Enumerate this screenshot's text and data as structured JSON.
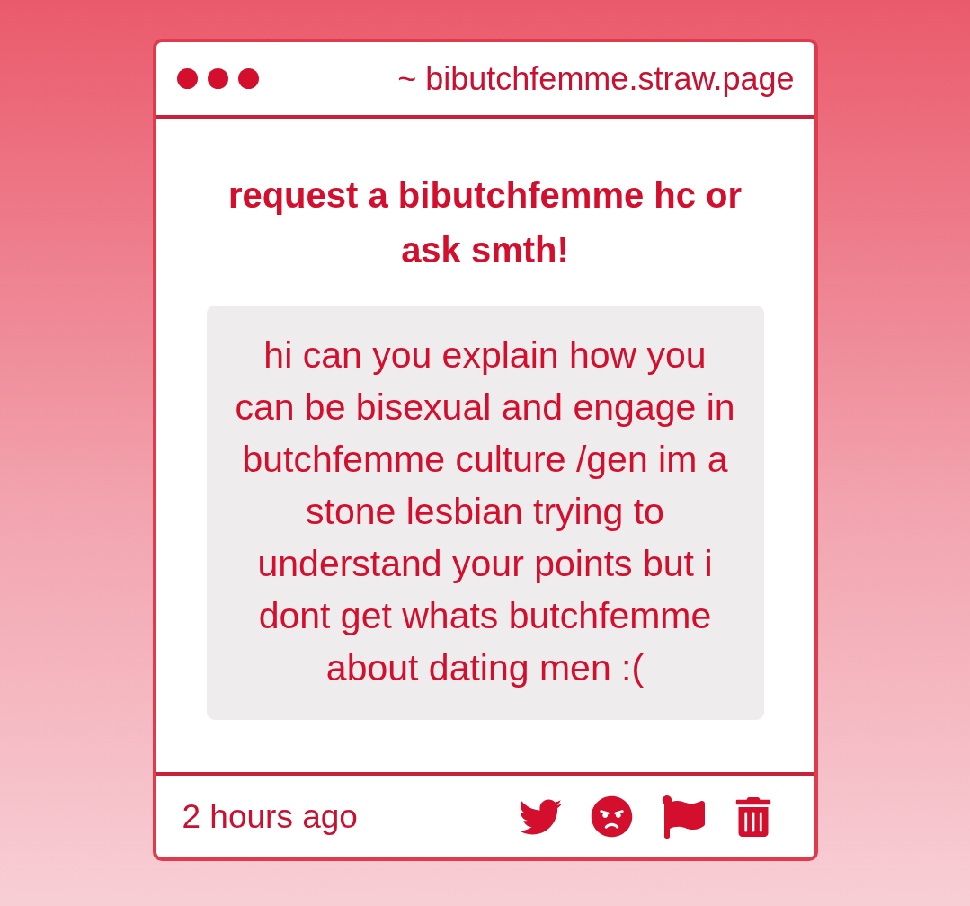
{
  "window": {
    "address": "~ bibutchfemme.straw.page"
  },
  "prompt": {
    "title": "request a bibutchfemme hc or ask smth!"
  },
  "question": {
    "text": "hi can you explain how you can be bisexual and engage in butchfemme culture /gen im a stone lesbian trying to understand your points but i dont get whats butchfemme about dating men :("
  },
  "footer": {
    "time": "2 hours ago",
    "actions": [
      {
        "kind": "share"
      },
      {
        "kind": "react"
      },
      {
        "kind": "report"
      },
      {
        "kind": "delete"
      }
    ]
  }
}
